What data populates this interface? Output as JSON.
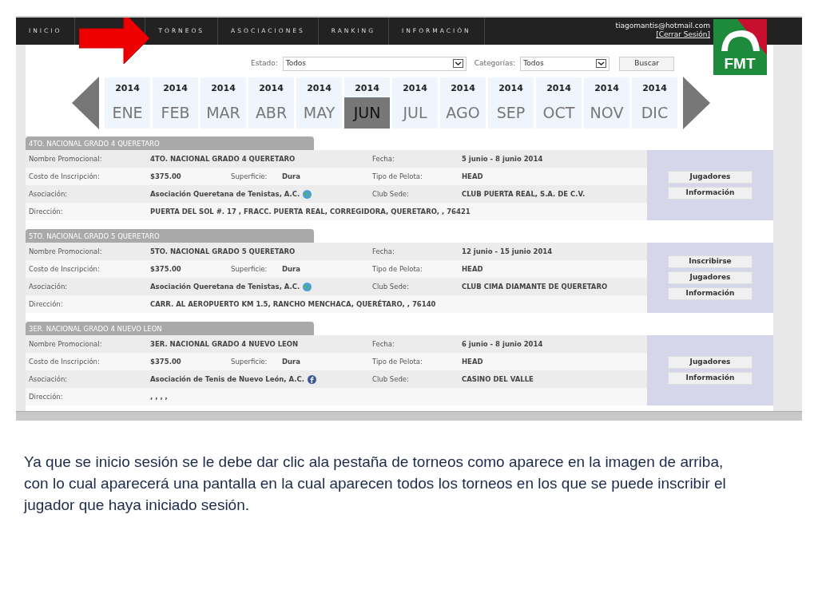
{
  "nav": [
    {
      "label": "INICIO"
    },
    {
      "kind": "covered"
    },
    {
      "label": "TORNEOS"
    },
    {
      "label": "ASOCIACIONES"
    },
    {
      "label": "RANKING"
    },
    {
      "label": "INFORMACIÓN"
    }
  ],
  "user": {
    "email": "tiagomantis@hotmail.com",
    "logout": "[Cerrar Sesión]"
  },
  "logo": {
    "text": "FMT"
  },
  "filters": {
    "estado_label": "Estado:",
    "estado_value": "Todos",
    "categorias_label": "Categorías:",
    "categorias_value": "Todos",
    "button": "Buscar"
  },
  "months": [
    {
      "year": "2014",
      "month": "ENE",
      "selected": false
    },
    {
      "year": "2014",
      "month": "FEB",
      "selected": false
    },
    {
      "year": "2014",
      "month": "MAR",
      "selected": false
    },
    {
      "year": "2014",
      "month": "ABR",
      "selected": false
    },
    {
      "year": "2014",
      "month": "MAY",
      "selected": false
    },
    {
      "year": "2014",
      "month": "JUN",
      "selected": true
    },
    {
      "year": "2014",
      "month": "JUL",
      "selected": false
    },
    {
      "year": "2014",
      "month": "AGO",
      "selected": false
    },
    {
      "year": "2014",
      "month": "SEP",
      "selected": false
    },
    {
      "year": "2014",
      "month": "OCT",
      "selected": false
    },
    {
      "year": "2014",
      "month": "NOV",
      "selected": false
    },
    {
      "year": "2014",
      "month": "DIC",
      "selected": false
    }
  ],
  "tournaments": [
    {
      "title": "4TO. NACIONAL GRADO 4 QUERETARO",
      "rows": [
        {
          "label": "Nombre Promocional:",
          "value": "4TO. NACIONAL GRADO 4 QUERETARO",
          "side_label": "Fecha:",
          "side_value": "5 junio - 8 junio 2014"
        },
        {
          "label": "Costo de Inscripción:",
          "value": "$375.00",
          "mid_label": "Superficie:",
          "mid_value": "Dura",
          "side_label": "Tipo de Pelota:",
          "side_value": "HEAD"
        },
        {
          "label": "Asociación:",
          "value": "Asociación Queretana de Tenistas, A.C.",
          "kind": "globe",
          "side_label": "Club Sede:",
          "side_value": "CLUB PUERTA REAL, S.A. DE C.V."
        },
        {
          "label": "Dirección:",
          "value": "PUERTA DEL SOL #. 17 , FRACC. PUERTA REAL, CORREGIDORA, QUERETARO, , 76421"
        }
      ],
      "buttons": [
        "Jugadores",
        "Información"
      ]
    },
    {
      "title": "5TO. NACIONAL GRADO 5 QUERETARO",
      "rows": [
        {
          "label": "Nombre Promocional:",
          "value": "5TO. NACIONAL GRADO 5 QUERETARO",
          "side_label": "Fecha:",
          "side_value": "12 junio - 15 junio 2014"
        },
        {
          "label": "Costo de Inscripción:",
          "value": "$375.00",
          "mid_label": "Superficie:",
          "mid_value": "Dura",
          "side_label": "Tipo de Pelota:",
          "side_value": "HEAD"
        },
        {
          "label": "Asociación:",
          "value": "Asociación Queretana de Tenistas, A.C.",
          "kind": "globe",
          "side_label": "Club Sede:",
          "side_value": "CLUB CIMA DIAMANTE DE QUERETARO"
        },
        {
          "label": "Dirección:",
          "value": "CARR. AL AEROPUERTO KM 1.5, RANCHO MENCHACA, QUERÉTARO, , 76140"
        }
      ],
      "buttons": [
        "Inscribirse",
        "Jugadores",
        "Información"
      ]
    },
    {
      "title": "3ER. NACIONAL GRADO 4 NUEVO LEON",
      "rows": [
        {
          "label": "Nombre Promocional:",
          "value": "3ER. NACIONAL GRADO 4 NUEVO LEON",
          "side_label": "Fecha:",
          "side_value": "6 junio - 8 junio 2014"
        },
        {
          "label": "Costo de Inscripción:",
          "value": "$375.00",
          "mid_label": "Superficie:",
          "mid_value": "Dura",
          "side_label": "Tipo de Pelota:",
          "side_value": "HEAD"
        },
        {
          "label": "Asociación:",
          "value": "Asociación de Tenis de Nuevo León, A.C.",
          "kind": "facebook",
          "side_label": "Club Sede:",
          "side_value": "CASINO DEL VALLE"
        },
        {
          "label": "Dirección:",
          "value": ", , , ,"
        }
      ],
      "buttons": [
        "Jugadores",
        "Información"
      ]
    }
  ],
  "caption": "Ya que se inicio sesión se le debe dar clic ala pestaña de torneos como aparece en la imagen de arriba, con lo cual aparecerá una pantalla en la cual aparecen todos los torneos en los que se puede inscribir el jugador que haya iniciado sesión."
}
